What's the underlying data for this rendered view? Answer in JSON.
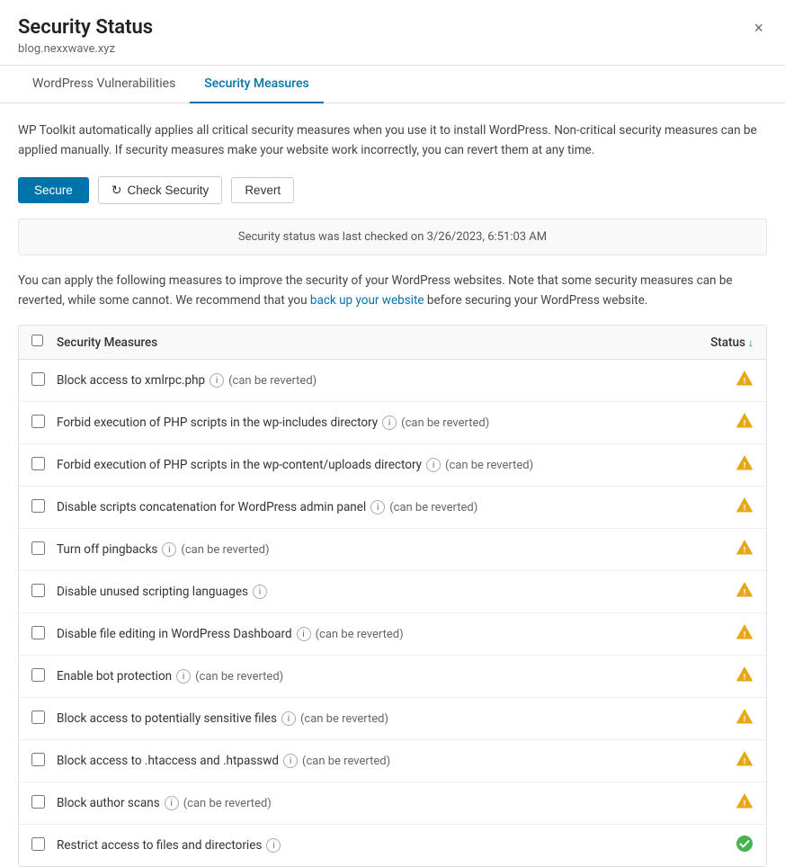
{
  "header": {
    "title": "Security Status",
    "subtitle": "blog.nexxwave.xyz",
    "close_label": "×"
  },
  "tabs": [
    {
      "id": "wp-vulnerabilities",
      "label": "WordPress Vulnerabilities",
      "active": false
    },
    {
      "id": "security-measures",
      "label": "Security Measures",
      "active": true
    }
  ],
  "description": "WP Toolkit automatically applies all critical security measures when you use it to install WordPress. Non-critical security measures can be applied manually. If security measures make your website work incorrectly, you can revert them at any time.",
  "actions": {
    "secure_label": "Secure",
    "check_label": "Check Security",
    "revert_label": "Revert"
  },
  "status_banner": "Security status was last checked on 3/26/2023, 6:51:03 AM",
  "info_text_before": "You can apply the following measures to improve the security of your WordPress websites. Note that some security measures can be reverted, while some cannot. We recommend that you",
  "info_link": "back up your website",
  "info_text_after": "before securing your WordPress website.",
  "table": {
    "header": {
      "measure_label": "Security Measures",
      "status_label": "Status"
    },
    "rows": [
      {
        "id": "block-xmlrpc",
        "label": "Block access to xmlrpc.php",
        "has_info": true,
        "can_revert": true,
        "status": "warning"
      },
      {
        "id": "forbid-php-includes",
        "label": "Forbid execution of PHP scripts in the wp-includes directory",
        "has_info": true,
        "can_revert": true,
        "status": "warning"
      },
      {
        "id": "forbid-php-uploads",
        "label": "Forbid execution of PHP scripts in the wp-content/uploads directory",
        "has_info": true,
        "can_revert": true,
        "status": "warning"
      },
      {
        "id": "disable-scripts-concat",
        "label": "Disable scripts concatenation for WordPress admin panel",
        "has_info": true,
        "can_revert": true,
        "status": "warning"
      },
      {
        "id": "turn-off-pingbacks",
        "label": "Turn off pingbacks",
        "has_info": true,
        "can_revert": true,
        "status": "warning"
      },
      {
        "id": "disable-scripting-languages",
        "label": "Disable unused scripting languages",
        "has_info": true,
        "can_revert": false,
        "status": "warning"
      },
      {
        "id": "disable-file-editing",
        "label": "Disable file editing in WordPress Dashboard",
        "has_info": true,
        "can_revert": true,
        "status": "warning"
      },
      {
        "id": "bot-protection",
        "label": "Enable bot protection",
        "has_info": true,
        "can_revert": true,
        "status": "warning"
      },
      {
        "id": "block-sensitive-files",
        "label": "Block access to potentially sensitive files",
        "has_info": true,
        "can_revert": true,
        "status": "warning"
      },
      {
        "id": "block-htaccess",
        "label": "Block access to .htaccess and .htpasswd",
        "has_info": true,
        "can_revert": true,
        "status": "warning"
      },
      {
        "id": "block-author-scans",
        "label": "Block author scans",
        "has_info": true,
        "can_revert": true,
        "status": "warning"
      },
      {
        "id": "restrict-files-dirs",
        "label": "Restrict access to files and directories",
        "has_info": true,
        "can_revert": false,
        "status": "success"
      }
    ]
  }
}
